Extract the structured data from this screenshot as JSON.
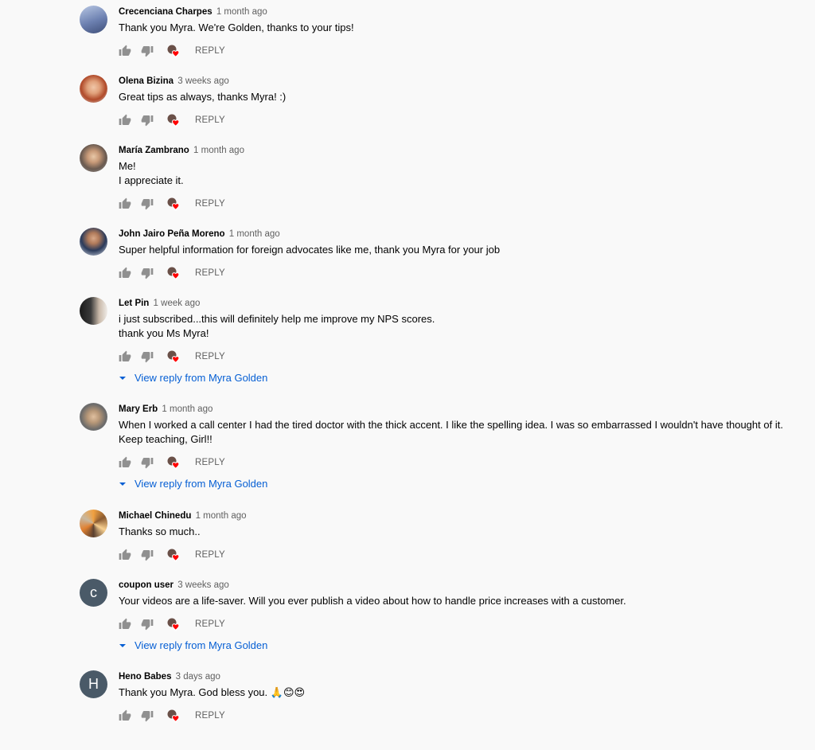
{
  "comments": [
    {
      "author": "Crecenciana Charpes",
      "time": "1 month ago",
      "text": "Thank you Myra. We're Golden, thanks to your tips!",
      "reply_label": "REPLY",
      "avatar": "photo",
      "avatar_color": "#5a6e9a"
    },
    {
      "author": "Olena Bizina",
      "time": "3 weeks ago",
      "text": "Great tips as always, thanks Myra! :)",
      "reply_label": "REPLY",
      "avatar": "photo",
      "avatar_color": "#b8704a"
    },
    {
      "author": "María Zambrano",
      "time": "1 month ago",
      "text": "Me!\nI appreciate it.",
      "reply_label": "REPLY",
      "avatar": "photo",
      "avatar_color": "#7b6a5e"
    },
    {
      "author": "John Jairo Peña Moreno",
      "time": "1 month ago",
      "text": "Super helpful information for foreign advocates like me, thank you Myra for your job",
      "reply_label": "REPLY",
      "avatar": "photo",
      "avatar_color": "#2f3d5c"
    },
    {
      "author": "Let Pin",
      "time": "1 week ago",
      "text": "i just subscribed...this will definitely help me improve my NPS scores.\nthank you Ms Myra!",
      "reply_label": "REPLY",
      "avatar": "photo",
      "avatar_color": "#3a3a3a",
      "view_reply": "View reply from Myra Golden"
    },
    {
      "author": "Mary Erb",
      "time": "1 month ago",
      "text": "When I worked a call center I had the tired doctor with the thick accent. I like the spelling idea. I was so embarrassed I wouldn't have thought of it.\nKeep teaching,  Girl!!",
      "reply_label": "REPLY",
      "avatar": "photo",
      "avatar_color": "#8a7a68",
      "view_reply": "View reply from Myra Golden"
    },
    {
      "author": "Michael Chinedu",
      "time": "1 month ago",
      "text": "Thanks so much..",
      "reply_label": "REPLY",
      "avatar": "photo",
      "avatar_color": "#c07a3a"
    },
    {
      "author": "coupon user",
      "time": "3 weeks ago",
      "text": "Your videos are a life-saver. Will you ever publish a video about how to handle price increases with a customer.",
      "reply_label": "REPLY",
      "avatar": "letter",
      "avatar_letter": "c",
      "avatar_color": "#4a5a68",
      "view_reply": "View reply from Myra Golden"
    },
    {
      "author": "Heno Babes",
      "time": "3 days ago",
      "text": "Thank you Myra. God bless you. 🙏😊😍",
      "reply_label": "REPLY",
      "avatar": "letter",
      "avatar_letter": "H",
      "avatar_color": "#4a5a68"
    }
  ],
  "colors": {
    "link": "#065fd4",
    "icon": "#909090",
    "heart": "#ff0000",
    "meta": "#606060"
  },
  "icons": [
    "thumb-up-icon",
    "thumb-down-icon",
    "creator-heart-icon",
    "caret-down-icon"
  ]
}
